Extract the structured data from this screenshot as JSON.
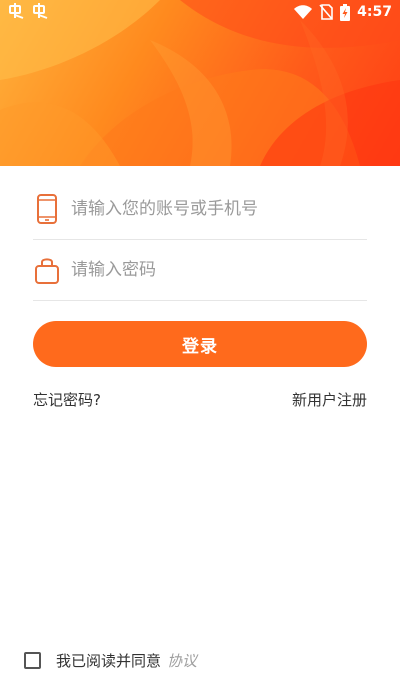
{
  "status_bar": {
    "time": "4:57",
    "left_icons": [
      "notification-icon",
      "notification-icon"
    ],
    "right_icons": [
      "wifi-icon",
      "no-sim-icon",
      "battery-charging-icon"
    ]
  },
  "banner": {
    "colors": [
      "#ffb23c",
      "#ff8a1e",
      "#ff5a1a",
      "#ff3d14"
    ]
  },
  "login_form": {
    "account_placeholder": "请输入您的账号或手机号",
    "account_icon": "phone-icon",
    "password_placeholder": "请输入密码",
    "password_icon": "lock-icon",
    "login_label": "登录",
    "forgot_label": "忘记密码?",
    "register_label": "新用户注册"
  },
  "agreement": {
    "text": "我已阅读并同意",
    "protocol": "协议"
  },
  "colors": {
    "accent": "#ff6a1c",
    "icon": "#e8703a",
    "text": "#333333",
    "placeholder": "#9a9a9a"
  }
}
